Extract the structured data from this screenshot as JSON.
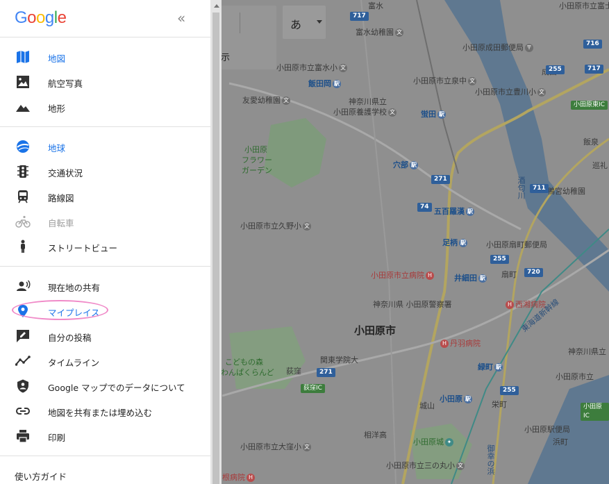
{
  "app": {
    "logo": "Google",
    "collapse_label": "«"
  },
  "menu": {
    "group1": [
      {
        "label": "地図",
        "icon": "map-icon",
        "active": true
      },
      {
        "label": "航空写真",
        "icon": "satellite-icon"
      },
      {
        "label": "地形",
        "icon": "terrain-icon"
      }
    ],
    "group2": [
      {
        "label": "地球",
        "icon": "globe-icon",
        "active": true
      },
      {
        "label": "交通状況",
        "icon": "traffic-icon"
      },
      {
        "label": "路線図",
        "icon": "transit-icon"
      },
      {
        "label": "自転車",
        "icon": "bicycle-icon",
        "disabled": true
      },
      {
        "label": "ストリートビュー",
        "icon": "pegman-icon"
      }
    ],
    "group3": [
      {
        "label": "現在地の共有",
        "icon": "location-sharing-icon"
      },
      {
        "label": "マイプレイス",
        "icon": "pin-icon",
        "active": true
      },
      {
        "label": "自分の投稿",
        "icon": "contributions-icon"
      },
      {
        "label": "タイムライン",
        "icon": "timeline-icon"
      },
      {
        "label": "Google マップでのデータについて",
        "icon": "privacy-shield-icon"
      },
      {
        "label": "地図を共有または埋め込む",
        "icon": "link-icon"
      },
      {
        "label": "印刷",
        "icon": "print-icon"
      }
    ],
    "footer": {
      "label": "使い方ガイド"
    }
  },
  "top_controls": {
    "input_fragment": "示",
    "language_label": "あ"
  },
  "map": {
    "labels": {
      "l1": "富水",
      "l2": "富水幼稚園",
      "l3": "小田原市立富水小",
      "l4": "飯田岡",
      "l5": "友愛幼稚園",
      "l6": "神奈川県立",
      "l7": "小田原養護学校",
      "l8": "小田原市立泉中",
      "l9": "蛍田",
      "l10": "小田原",
      "l11": "フラワー",
      "l12": "ガーデン",
      "l13": "穴部",
      "l14": "五百羅漢",
      "l15": "小田原市立久野小",
      "l16": "足柄",
      "l17": "小田原市立病院",
      "l18": "井細田",
      "l19": "神奈川県 小田原警察署",
      "l20": "小田原市",
      "l21": "丹羽病院",
      "l22": "西湘病院",
      "l23": "こどもの森",
      "l24": "わんぱくらんど",
      "l25": "荻窪",
      "l26": "関東学院大",
      "l27": "緑町",
      "l28": "小田原",
      "l29": "城山",
      "l30": "栄町",
      "l31": "相洋高",
      "l32": "小田原城",
      "l33": "小田原市立大窪小",
      "l34": "小田原市立三の丸小",
      "l35": "根病院",
      "l36": "小田原市立富士",
      "l37": "小田原成田郵便局",
      "l38": "成田",
      "l39": "小田原市立豊川小",
      "l40": "飯泉",
      "l41": "巡礼",
      "l42": "鴨宮幼稚園",
      "l43": "小田原扇町郵便局",
      "l44": "扇町",
      "l45": "神奈川県立",
      "l46": "小田原市立",
      "l47": "小田原駅便局",
      "l48": "浜町",
      "l49": "酒匂川",
      "l50": "東海道新幹線",
      "l51": "御幸の浜"
    },
    "shields": {
      "s1": "717",
      "s2": "716",
      "s3": "255",
      "s4": "717",
      "s5": "271",
      "s6": "74",
      "s7": "711",
      "s8": "255",
      "s9": "720",
      "s10": "271",
      "s11": "255",
      "s12": "小田原東IC",
      "s13": "荻窪IC",
      "s14": "小田原IC"
    }
  },
  "colors": {
    "accent": "#1a73e8",
    "highlight": "#f08ac8"
  }
}
